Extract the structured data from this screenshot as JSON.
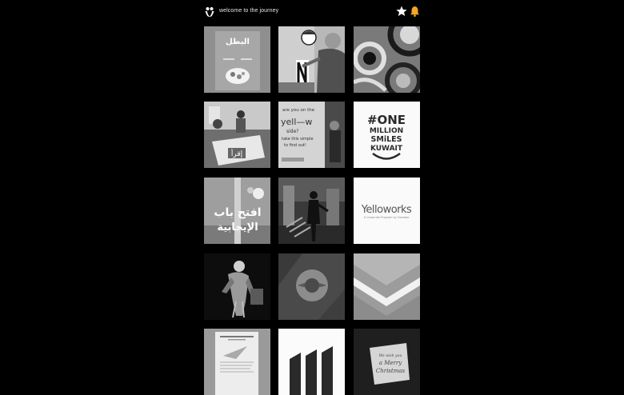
{
  "header": {
    "title": "welcome to the journey",
    "logo_icon": "people-logo-icon",
    "favorite_icon": "star-icon",
    "notification_icon": "bell-icon",
    "accent_color": "#f5a623"
  },
  "tiles": [
    {
      "id": "t1",
      "name": "arabic-brand-poster"
    },
    {
      "id": "t2",
      "name": "man-painting-wall"
    },
    {
      "id": "t3",
      "name": "swirl-mural"
    },
    {
      "id": "t4",
      "name": "booth-reading-sign"
    },
    {
      "id": "t5",
      "name": "yellow-side-sign"
    },
    {
      "id": "t6",
      "name": "one-million-smiles-logo"
    },
    {
      "id": "t7",
      "name": "arabic-positive-door"
    },
    {
      "id": "t8",
      "name": "silhouette-gallery"
    },
    {
      "id": "t9",
      "name": "yelloworks-logo"
    },
    {
      "id": "t10",
      "name": "dark-character-art"
    },
    {
      "id": "t11",
      "name": "circle-flag-photo"
    },
    {
      "id": "t12",
      "name": "geometric-chevron"
    },
    {
      "id": "t13",
      "name": "paper-plane-document"
    },
    {
      "id": "t14",
      "name": "bar-columns-graphic"
    },
    {
      "id": "t15",
      "name": "merry-christmas-card"
    }
  ],
  "texts": {
    "t1_ar": "البطل",
    "t4_ar": "إقرأ",
    "t5_lines": [
      "are you on the",
      "yell—w",
      "side?",
      "take this simple",
      "to find out!"
    ],
    "t6_lines": [
      "#ONE",
      "MILLION",
      "SMiLES",
      "KUWAIT"
    ],
    "t7_lines": [
      "افتح باب",
      "الإيجابية"
    ],
    "t9_title": "Yelloworks",
    "t9_sub": "A Corporate Program by Ooredoo",
    "t15_lines": [
      "We wish you",
      "a Merry",
      "Christmas"
    ]
  }
}
